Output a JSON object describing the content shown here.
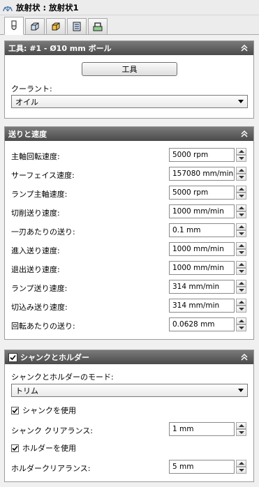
{
  "title": "放射状 : 放射状1",
  "tabs": [
    {
      "icon": "tool-icon",
      "active": true
    },
    {
      "icon": "geometry-icon",
      "active": false
    },
    {
      "icon": "heights-icon",
      "active": false
    },
    {
      "icon": "passes-icon",
      "active": false
    },
    {
      "icon": "linking-icon",
      "active": false
    }
  ],
  "tool_panel": {
    "header": "工具: #1 - Ø10 mm ボール",
    "tool_button": "工具",
    "coolant_label": "クーラント:",
    "coolant_value": "オイル"
  },
  "feed_panel": {
    "header": "送りと速度",
    "rows": [
      {
        "label": "主軸回転速度:",
        "value": "5000 rpm"
      },
      {
        "label": "サーフェイス速度:",
        "value": "157080 mm/min"
      },
      {
        "label": "ランプ主軸速度:",
        "value": "5000 rpm"
      },
      {
        "label": "切削送り速度:",
        "value": "1000 mm/min"
      },
      {
        "label": "一刃あたりの送り:",
        "value": "0.1 mm"
      },
      {
        "label": "進入送り速度:",
        "value": "1000 mm/min"
      },
      {
        "label": "退出送り速度:",
        "value": "1000 mm/min"
      },
      {
        "label": "ランプ送り速度:",
        "value": "314 mm/min"
      },
      {
        "label": "切込み送り速度:",
        "value": "314 mm/min"
      },
      {
        "label": "回転あたりの送り:",
        "value": "0.0628 mm"
      }
    ]
  },
  "shank_panel": {
    "header": "シャンクとホルダー",
    "checked": true,
    "mode_label": "シャンクとホルダーのモード:",
    "mode_value": "トリム",
    "use_shank_label": "シャンクを使用",
    "use_shank": true,
    "shank_clearance_label": "シャンク クリアランス:",
    "shank_clearance_value": "1 mm",
    "use_holder_label": "ホルダーを使用",
    "use_holder": true,
    "holder_clearance_label": "ホルダークリアランス:",
    "holder_clearance_value": "5 mm"
  },
  "colors": {
    "header_bg": "#5a5a5a",
    "panel_bg": "#ffffff",
    "page_bg": "#f0f0f0"
  }
}
